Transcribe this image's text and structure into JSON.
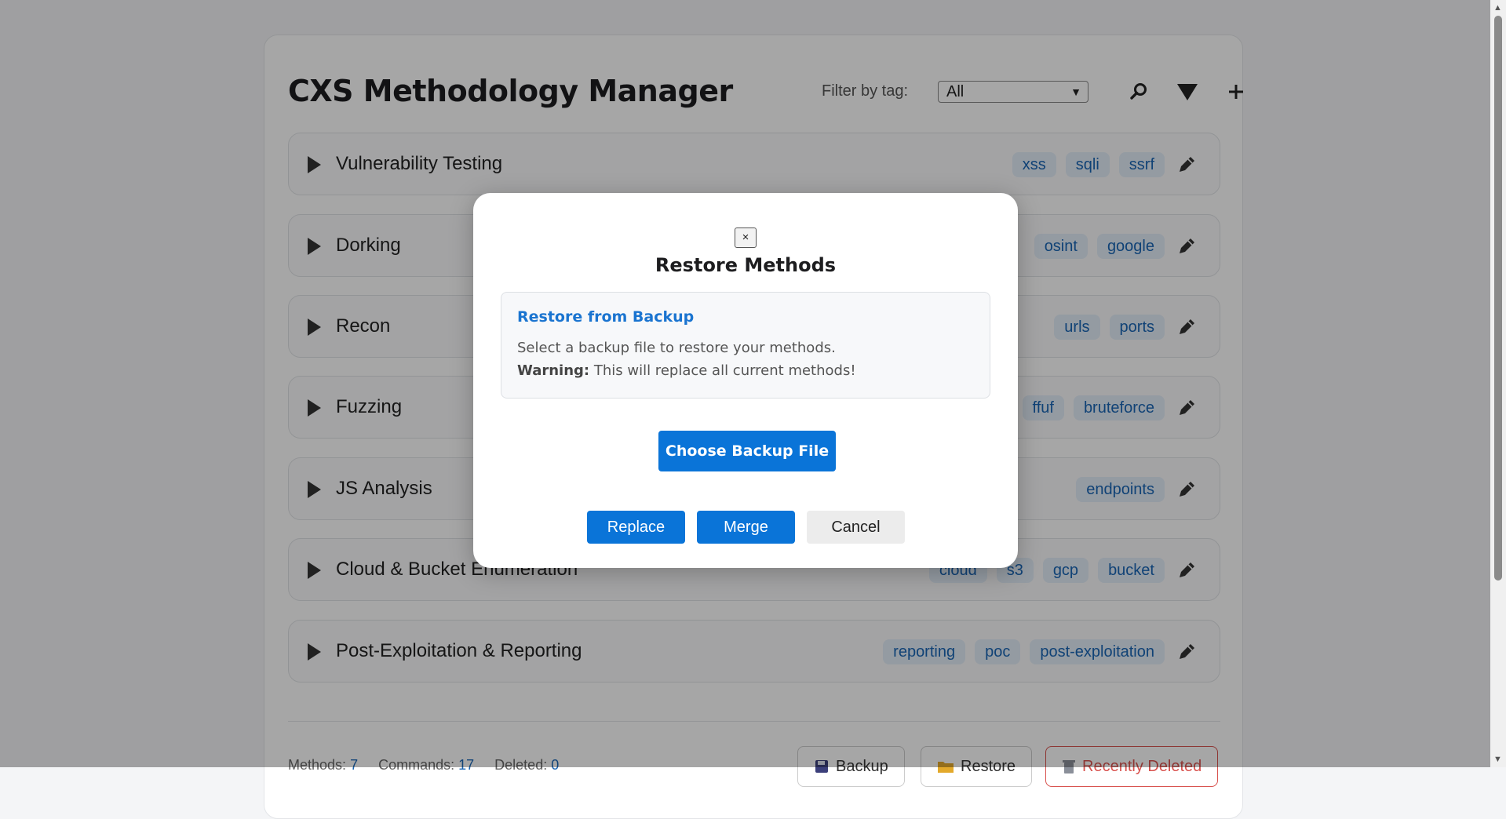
{
  "app": {
    "title": "CXS Methodology Manager",
    "filter_label": "Filter by tag:",
    "filter_value": "All",
    "accent_color": "#0a74d8"
  },
  "methods": [
    {
      "name": "Vulnerability Testing",
      "tags": [
        "xss",
        "sqli",
        "ssrf"
      ]
    },
    {
      "name": "Dorking",
      "tags": [
        "osint",
        "google"
      ]
    },
    {
      "name": "Recon",
      "tags": [
        "urls",
        "ports"
      ]
    },
    {
      "name": "Fuzzing",
      "tags": [
        "ffuf",
        "bruteforce"
      ]
    },
    {
      "name": "JS Analysis",
      "tags": [
        "endpoints"
      ]
    },
    {
      "name": "Cloud & Bucket Enumeration",
      "tags": [
        "cloud",
        "s3",
        "gcp",
        "bucket"
      ]
    },
    {
      "name": "Post-Exploitation & Reporting",
      "tags": [
        "reporting",
        "poc",
        "post-exploitation"
      ]
    }
  ],
  "footer": {
    "stats": [
      {
        "label": "Methods:",
        "value": "7"
      },
      {
        "label": "Commands:",
        "value": "17"
      },
      {
        "label": "Deleted:",
        "value": "0"
      }
    ],
    "backup_label": "Backup",
    "restore_label": "Restore",
    "deleted_label": "Recently Deleted"
  },
  "modal": {
    "close_label": "×",
    "title": "Restore Methods",
    "info_heading": "Restore from Backup",
    "info_text": "Select a backup file to restore your methods.",
    "warning_label": "Warning:",
    "warning_text": "This will replace all current methods!",
    "choose_label": "Choose Backup File",
    "replace_label": "Replace",
    "merge_label": "Merge",
    "cancel_label": "Cancel"
  },
  "icons": {
    "search": "search-icon",
    "filter": "filter-icon",
    "add": "plus-icon",
    "edit": "pencil-icon",
    "expand": "triangle-right-icon",
    "backup": "floppy-disk-icon",
    "restore": "folder-icon",
    "deleted": "trash-icon"
  }
}
